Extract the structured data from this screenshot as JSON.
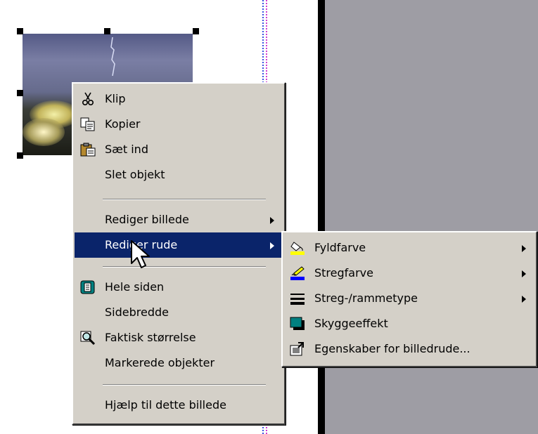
{
  "context_menu": {
    "items": [
      {
        "label": "Klip",
        "icon": "scissors-icon"
      },
      {
        "label": "Kopier",
        "icon": "copy-icon"
      },
      {
        "label": "Sæt ind",
        "icon": "paste-icon"
      },
      {
        "label": "Slet objekt"
      },
      {
        "label": "Rediger billede",
        "has_submenu": true
      },
      {
        "label": "Rediger rude",
        "has_submenu": true,
        "highlighted": true
      },
      {
        "label": "Hele siden",
        "icon": "whole-page-icon"
      },
      {
        "label": "Sidebredde"
      },
      {
        "label": "Faktisk størrelse",
        "icon": "zoom-icon"
      },
      {
        "label": "Markerede objekter"
      },
      {
        "label": "Hjælp til dette billede"
      }
    ]
  },
  "submenu": {
    "items": [
      {
        "label": "Fyldfarve",
        "icon": "fill-color-icon",
        "has_submenu": true
      },
      {
        "label": "Stregfarve",
        "icon": "line-color-icon",
        "has_submenu": true
      },
      {
        "label": "Streg-/rammetype",
        "icon": "line-style-icon",
        "has_submenu": true
      },
      {
        "label": "Skyggeeffekt",
        "icon": "shadow-icon"
      },
      {
        "label": "Egenskaber for billedrude...",
        "icon": "properties-icon"
      }
    ]
  },
  "colors": {
    "menu_bg": "#d4d0c8",
    "highlight": "#0a246a",
    "pane_gray": "#9e9da4",
    "fill_swatch": "#ffff00",
    "line_swatch": "#0000ff",
    "shadow_teal": "#008080"
  }
}
